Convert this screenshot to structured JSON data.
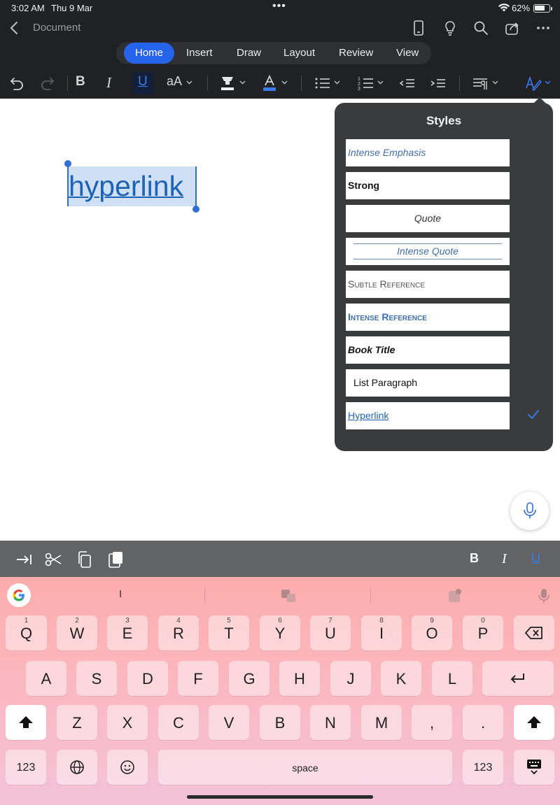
{
  "status_bar": {
    "time": "3:02 AM",
    "date": "Thu 9 Mar",
    "battery": "62%"
  },
  "header": {
    "doc_title": "Document"
  },
  "ribbon": {
    "tabs": [
      "Home",
      "Insert",
      "Draw",
      "Layout",
      "Review",
      "View"
    ],
    "active_tab": "Home",
    "bold": "B",
    "italic": "I",
    "underline": "U",
    "font_size": "aA"
  },
  "document": {
    "selected_text": "hyperlink"
  },
  "styles_panel": {
    "title": "Styles",
    "items": [
      "Intense Emphasis",
      "Strong",
      "Quote",
      "Intense Quote",
      "Subtle Reference",
      "Intense Reference",
      "Book Title",
      "List Paragraph",
      "Hyperlink"
    ],
    "selected": "Hyperlink"
  },
  "edit_bar": {
    "bold": "B",
    "italic": "I",
    "underline": "U"
  },
  "keyboard": {
    "suggestion": "I",
    "row1": [
      {
        "k": "Q",
        "n": "1"
      },
      {
        "k": "W",
        "n": "2"
      },
      {
        "k": "E",
        "n": "3"
      },
      {
        "k": "R",
        "n": "4"
      },
      {
        "k": "T",
        "n": "5"
      },
      {
        "k": "Y",
        "n": "6"
      },
      {
        "k": "U",
        "n": "7"
      },
      {
        "k": "I",
        "n": "8"
      },
      {
        "k": "O",
        "n": "9"
      },
      {
        "k": "P",
        "n": "0"
      }
    ],
    "row2": [
      "A",
      "S",
      "D",
      "F",
      "G",
      "H",
      "J",
      "K",
      "L"
    ],
    "row3": [
      "Z",
      "X",
      "C",
      "V",
      "B",
      "N",
      "M",
      ",",
      "."
    ],
    "numbers_key": "123",
    "space_key": "space"
  },
  "colors": {
    "accent": "#2563eb",
    "hyperlink": "#1f63b6",
    "chrome_bg": "#202124",
    "panel_bg": "#3a3b3d"
  }
}
